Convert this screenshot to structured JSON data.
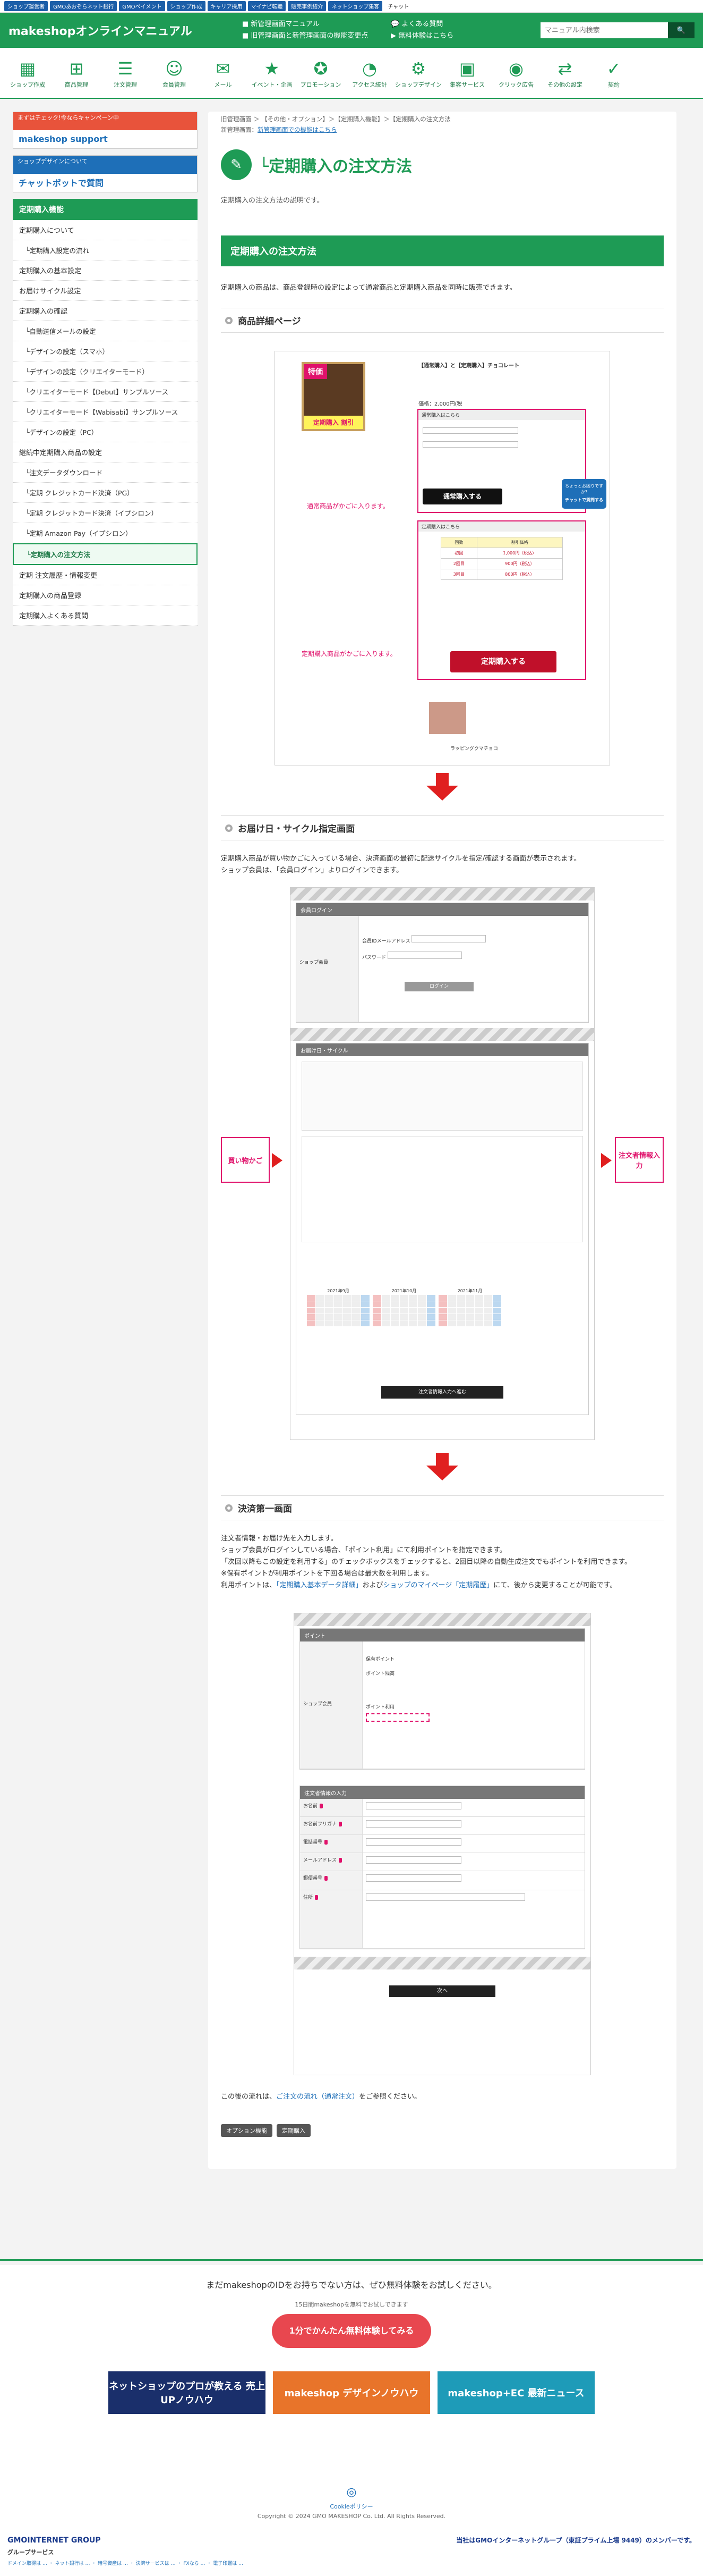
{
  "topbar": [
    "ショップ運営者",
    "GMOあおぞらネット銀行",
    "GMOペイメント",
    "ショップ作成",
    "キャリア採用",
    "マイナビ転職",
    "販売事例紹介",
    "ネットショップ集客",
    "チャット"
  ],
  "header": {
    "logo": "makeshopオンラインマニュアル",
    "news1": "新管理画面マニュアル",
    "news2": "旧管理画面と新管理画面の機能変更点",
    "link1": "よくある質問",
    "link2": "無料体験はこちら",
    "search_placeholder": "マニュアル内検索"
  },
  "categories": [
    {
      "icon": "▦",
      "label": "ショップ作成"
    },
    {
      "icon": "⊞",
      "label": "商品管理"
    },
    {
      "icon": "☰",
      "label": "注文管理"
    },
    {
      "icon": "☺",
      "label": "会員管理"
    },
    {
      "icon": "✉",
      "label": "メール"
    },
    {
      "icon": "★",
      "label": "イベント・企画"
    },
    {
      "icon": "✪",
      "label": "プロモーション"
    },
    {
      "icon": "◔",
      "label": "アクセス統計"
    },
    {
      "icon": "⚙",
      "label": "ショップデザイン"
    },
    {
      "icon": "▣",
      "label": "集客サービス"
    },
    {
      "icon": "◉",
      "label": "クリック広告"
    },
    {
      "icon": "⇄",
      "label": "その他の設定"
    },
    {
      "icon": "✓",
      "label": "契約"
    }
  ],
  "banners": [
    {
      "top": "まずはチェック!今ならキャンペーン中",
      "main": "makeshop support"
    },
    {
      "top": "ショップデザインについて",
      "main": "チャットボットで質問"
    }
  ],
  "sidemenu": {
    "head": "定期購入機能",
    "items": [
      {
        "t": "定期購入について",
        "lv": 1
      },
      {
        "t": "定期購入設定の流れ",
        "lv": 2
      },
      {
        "t": "定期購入の基本設定",
        "lv": 1
      },
      {
        "t": "お届けサイクル設定",
        "lv": 1
      },
      {
        "t": "定期購入の確認",
        "lv": 1
      },
      {
        "t": "自動送信メールの設定",
        "lv": 2
      },
      {
        "t": "デザインの設定（スマホ）",
        "lv": 2
      },
      {
        "t": "デザインの設定（クリエイターモード）",
        "lv": 2
      },
      {
        "t": "クリエイターモード【Debut】サンプルソース",
        "lv": 2
      },
      {
        "t": "クリエイターモード【Wabisabi】サンプルソース",
        "lv": 2
      },
      {
        "t": "デザインの設定（PC）",
        "lv": 2
      },
      {
        "t": "継続中定期購入商品の設定",
        "lv": 1
      },
      {
        "t": "注文データダウンロード",
        "lv": 2
      },
      {
        "t": "定期 クレジットカード決済（PG）",
        "lv": 2
      },
      {
        "t": "定期 クレジットカード決済（イプシロン）",
        "lv": 2
      },
      {
        "t": "定期 Amazon Pay（イプシロン）",
        "lv": 2
      },
      {
        "t": "定期購入の注文方法",
        "lv": 2,
        "active": true
      },
      {
        "t": "定期 注文履歴・情報変更",
        "lv": 1
      },
      {
        "t": "定期購入の商品登録",
        "lv": 1
      },
      {
        "t": "定期購入よくある質問",
        "lv": 1
      }
    ]
  },
  "breadcrumb": {
    "line1": "旧管理画面 ＞ 【その他・オプション】＞【定期購入機能】＞【定期購入の注文方法",
    "line2_prefix": "新管理画面：",
    "line2_link": "新管理画面での機能はこちら"
  },
  "page": {
    "title": "└定期購入の注文方法",
    "lead": "定期購入の注文方法の説明です。",
    "section_title": "定期購入の注文方法",
    "section_intro": "定期購入の商品は、商品登録時の設定によって通常商品と定期購入商品を同時に販売できます。",
    "h3_1": "商品詳細ページ",
    "h3_2": "お届け日・サイクル指定画面",
    "h3_3": "決済第一画面",
    "s2_p1": "定期購入商品が買い物かごに入っている場合、決済画面の最初に配送サイクルを指定/確認する画面が表示されます。",
    "s2_p2": "ショップ会員は、「会員ログイン」よりログインできます。",
    "s3_p1": "注文者情報・お届け先を入力します。",
    "s3_p2": "ショップ会員がログインしている場合、「ポイント利用」にて利用ポイントを指定できます。",
    "s3_p3": "「次回以降もこの設定を利用する」のチェックボックスをチェックすると、2回目以降の自動生成注文でもポイントを利用できます。",
    "s3_p4": "※保有ポイントが利用ポイントを下回る場合は最大数を利用します。",
    "s3_p5_a": "利用ポイントは、",
    "s3_p5_link1": "「定期購入基本データ詳細」",
    "s3_p5_b": "および",
    "s3_p5_link2": "ショップのマイページ「定期履歴」",
    "s3_p5_c": "にて、後から変更することが可能です。",
    "closing_a": "この後の流れは、",
    "closing_link": "ご注文の流れ（通常注文）",
    "closing_b": "をご参照ください。",
    "tags": [
      "オプション機能",
      "定期購入"
    ]
  },
  "shot1": {
    "product_name": "【通常購入】と【定期購入】チョコレート",
    "price": "価格：2,000円(税",
    "regular_title": "通常購入はこちら",
    "regular_btn": "通常購入する",
    "sub_title": "定期購入はこちら",
    "sub_btn": "定期購入する",
    "note_regular": "通常商品がかごに入ります。",
    "note_sub": "定期購入商品がかごに入ります。",
    "badge": "特価",
    "promo": "定期購入 割引",
    "chat1": "ちょっとお困りですか?",
    "chat2": "チャットで質問する",
    "related": "ラッピングクマチョコ"
  },
  "shot1_table": [
    [
      "回数",
      "割引価格"
    ],
    [
      "初回",
      "1,000円（税込）"
    ],
    [
      "2回目",
      "900円（税込）"
    ],
    [
      "3回目",
      "800円（税込）"
    ]
  ],
  "shot2": {
    "login_head": "会員ログイン",
    "shop_member": "ショップ会員",
    "email_label": "会員IDメールアドレス",
    "pw_label": "パスワード",
    "login_btn": "ログイン",
    "cycle_head": "お届け日・サイクル",
    "confirm_btn": "注文者情報入力へ進む",
    "left_label": "買い物かご",
    "right_label": "注文者情報入力",
    "cal_months": [
      "2021年9月",
      "2021年10月",
      "2021年11月"
    ]
  },
  "shot3": {
    "point_head": "ポイント",
    "shop_member": "ショップ会員",
    "owned": "保有ポイント",
    "available": "ポイント残高",
    "use": "ポイント利用",
    "buyer_head": "注文者情報の入力",
    "fields": [
      "お名前",
      "お名前フリガナ",
      "電話番号",
      "メールアドレス",
      "郵便番号",
      "住所"
    ],
    "next_btn": "次へ"
  },
  "footer": {
    "cta_title": "まだmakeshopのIDをお持ちでない方は、ぜひ無料体験をお試しください。",
    "cta_sub": "15日間makeshopを無料でお試しできます",
    "cta_btn": "1分でかんたん無料体験してみる",
    "banners": [
      {
        "t": "ネットショップのプロが教える 売上UPノウハウ"
      },
      {
        "t": "makeshop デザインノウハウ"
      },
      {
        "t": "makeshop+EC 最新ニュース"
      }
    ],
    "cookie": "Cookieポリシー",
    "copyright": "Copyright © 2024 GMO MAKESHOP Co. Ltd. All Rights Reserved.",
    "gmo_left": "GMOINTERNET GROUP",
    "gmo_right": "当社はGMOインターネットグループ（東証プライム上場 9449）のメンバーです。",
    "group_title": "グループサービス",
    "group_links": "ドメイン取得は … ・ ネット銀行は … ・ 暗号資産は … ・ 決済サービスは … ・ FXなら … ・ 電子印鑑は …"
  },
  "colors": {
    "brand": "#1e9b55",
    "accent": "#e0126b",
    "cta": "#e8474f"
  }
}
